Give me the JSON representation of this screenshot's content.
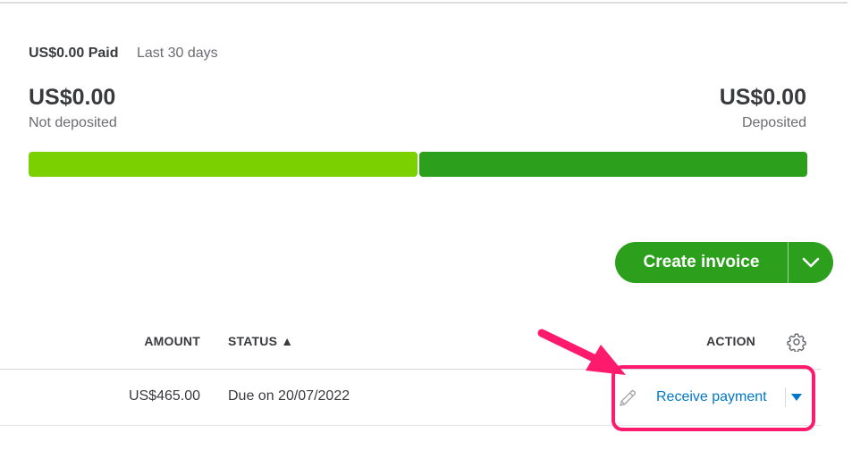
{
  "summary": {
    "paid_amount": "US$0.00 Paid",
    "period": "Last 30 days",
    "not_deposited_amount": "US$0.00",
    "not_deposited_label": "Not deposited",
    "deposited_amount": "US$0.00",
    "deposited_label": "Deposited"
  },
  "progress": {
    "not_deposited_fraction": 0.5,
    "deposited_fraction": 0.5,
    "not_deposited_color": "#7ad000",
    "deposited_color": "#2ca01c"
  },
  "actions": {
    "create_invoice_label": "Create invoice",
    "create_invoice_color": "#2ca01c",
    "create_invoice_dropdown_icon": "chevron-down-icon"
  },
  "table": {
    "columns": {
      "amount": "AMOUNT",
      "status": "STATUS ▲",
      "action": "ACTION"
    },
    "settings_icon": "gear-icon",
    "rows": [
      {
        "amount": "US$465.00",
        "status": "Due on 20/07/2022",
        "action_label": "Receive payment",
        "edit_icon": "pencil-icon",
        "more_icon": "caret-down-icon"
      }
    ]
  },
  "colors": {
    "link": "#0077c5",
    "annotation": "#ff1a6e"
  }
}
